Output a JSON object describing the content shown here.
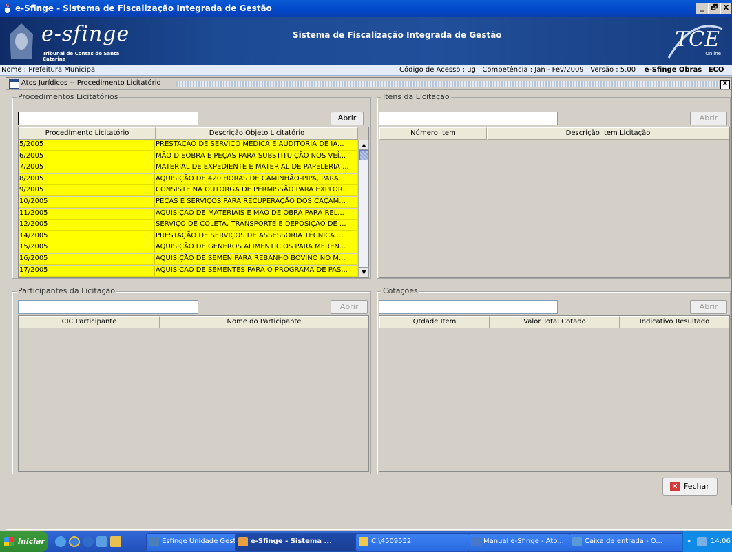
{
  "window": {
    "title": "e-Sfinge - Sistema de Fiscalização Integrada de Gestão",
    "min": "_",
    "max": "🗗",
    "close": "X"
  },
  "banner": {
    "logo_text": "e-sfinge",
    "logo_sub": "Tribunal de Contas de Santa Catarina",
    "center_title": "Sistema de Fiscalização Integrada de Gestão",
    "tce_text": "TCE",
    "tce_online": "Online"
  },
  "infobar": {
    "nome": "Nome : Prefeitura Municipal",
    "codigo": "Código de Acesso : ug",
    "competencia": "Competência : Jan - Fev/2009",
    "versao": "Versão : 5.00",
    "module": "e-Sfinge Obras",
    "eco": "ECO"
  },
  "frame": {
    "title": "Atos Jurídicos -- Procedimento Licitatório",
    "close": "X"
  },
  "procedimentos": {
    "title": "Procedimentos Licitatórios",
    "search_value": "",
    "abrir": "Abrir",
    "columns": [
      "Procedimento Licitatório",
      "Descrição Objeto Licitatório"
    ],
    "rows": [
      {
        "proc": "5/2005",
        "desc": "PRESTAÇÃO DE SERVIÇO MÉDICA E AUDITORIA DE IA..."
      },
      {
        "proc": "6/2005",
        "desc": "MÃO D EOBRA E PEÇAS PARA SUBSTITUIÇÃO NOS VEÍ..."
      },
      {
        "proc": "7/2005",
        "desc": "MATERIAL DE EXPEDIENTE E MATERIAL DE PAPELERIA ..."
      },
      {
        "proc": "8/2005",
        "desc": "AQUISIÇÃO DE 420 HORAS DE CAMINHÃO-PIPA, PARA..."
      },
      {
        "proc": "9/2005",
        "desc": "CONSISTE NA OUTORGA DE PERMISSÃO PARA EXPLOR..."
      },
      {
        "proc": "10/2005",
        "desc": "PEÇAS E SERVIÇOS PARA RECUPERAÇÃO DOS CAÇAM..."
      },
      {
        "proc": "11/2005",
        "desc": "AQUISIÇÃO DE MATERIAIS E MÃO DE OBRA PARA REL..."
      },
      {
        "proc": "12/2005",
        "desc": "SERVIÇO DE COLETA, TRANSPORTE E DEPOSIÇÃO DE ..."
      },
      {
        "proc": "14/2005",
        "desc": "PRESTAÇÃO DE SERVIÇOS DE  ASSESSORIA TÉCNICA ..."
      },
      {
        "proc": "15/2005",
        "desc": "AQUISIÇÃO DE GENEROS ALIMENTICIOS PARA MEREN..."
      },
      {
        "proc": "16/2005",
        "desc": "AQUISIÇÃO DE SEMEN PARA REBANHO BOVINO NO M..."
      },
      {
        "proc": "17/2005",
        "desc": "AQUISIÇÃO DE SEMENTES PARA O PROGRAMA DE PAS..."
      }
    ]
  },
  "itens": {
    "title": "Itens da Licitação",
    "abrir": "Abrir",
    "columns": [
      "Número Item",
      "Descrição Item Licitação"
    ]
  },
  "participantes": {
    "title": "Participantes da Licitação",
    "abrir": "Abrir",
    "columns": [
      "CIC Participante",
      "Nome do Participante"
    ]
  },
  "cotacoes": {
    "title": "Cotações",
    "abrir": "Abrir",
    "columns": [
      "Qtdade Item",
      "Valor Total Cotado",
      "Indicativo Resultado"
    ]
  },
  "fechar": "Fechar",
  "taskbar": {
    "start": "Iniciar",
    "items": [
      "Esfinge Unidade Gestora",
      "e-Sfinge - Sistema ...",
      "C:\\4509552",
      "Manual e-Sfinge - Ato...",
      "Caixa de entrada - O..."
    ],
    "clock": "14:06",
    "tray_expand": "«"
  }
}
